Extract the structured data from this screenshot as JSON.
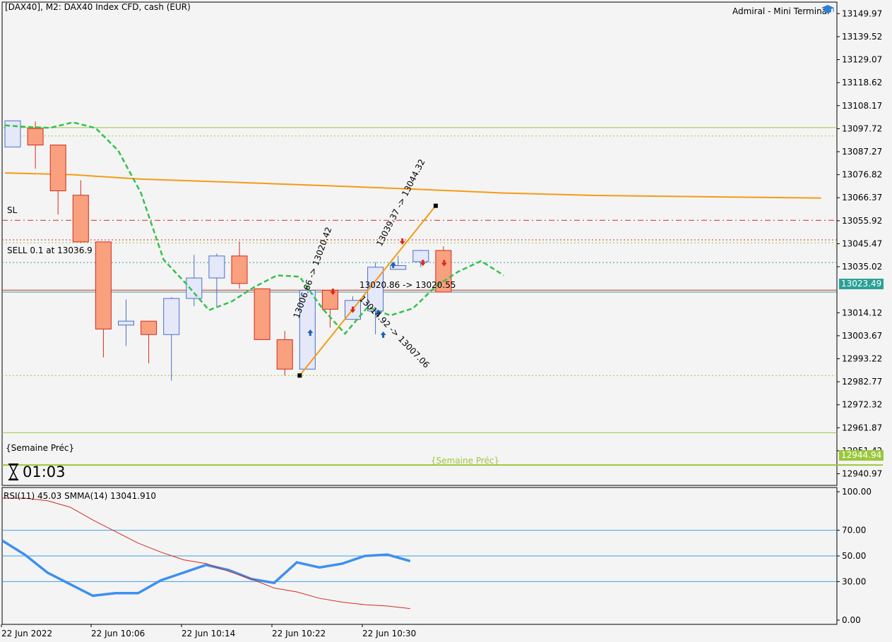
{
  "header": {
    "symbol_info": "[DAX40], M2:  DAX40 Index CFD, cash (EUR)",
    "terminal_name": "Admiral - Mini Terminal"
  },
  "labels": {
    "sl": "SL",
    "sell": "SELL 0.1 at 13036.9",
    "semaine_left": "{Semaine Préc}",
    "semaine_center": "{Semaine Préc}",
    "timer": "01:03",
    "current_price": "13023.49",
    "week_price": "12944.94"
  },
  "trade_annotations": [
    {
      "text": "13006.66 -> 13020.42",
      "x0": 7,
      "y0": 13006.66,
      "x1": 11,
      "y1": 13020.42
    },
    {
      "text": "13039.37 -> 13044.32",
      "x0": 13,
      "y0": 13039.37,
      "x1": 15,
      "y1": 13044.32
    },
    {
      "text": "13020.86 -> 13020.55",
      "x0": 9,
      "y0": 13020.86,
      "x1": 10,
      "y1": 13020.55
    },
    {
      "text": "13014.92 -> 13007.06",
      "x0": 10,
      "y0": 13014.92,
      "x1": 11,
      "y1": 13007.06
    }
  ],
  "colors": {
    "bull_body": "#e4e8f8",
    "bull_border": "#4a6fc7",
    "bear_body": "#f9a07e",
    "bear_border": "#d42a1e",
    "ma_orange": "#f39c12",
    "ma_green": "#33c14a",
    "rsi_line": "#3d8ff0",
    "smma_line": "#d42a1e",
    "price_tag_bg": "#2aa198",
    "week_tag_bg": "#9ac83a"
  },
  "chart_data": [
    {
      "type": "candlestick",
      "title": "[DAX40], M2:  DAX40 Index CFD, cash (EUR)",
      "ylim": [
        12935.7,
        13155.2
      ],
      "y_ticks": [
        13149.97,
        13139.52,
        13129.07,
        13118.62,
        13108.17,
        13097.72,
        13087.27,
        13076.82,
        13066.37,
        13055.92,
        13045.47,
        13035.02,
        13014.12,
        13003.67,
        12993.22,
        12982.77,
        12972.32,
        12961.87,
        12951.42,
        12940.97
      ],
      "x_ticks": [
        "22 Jun 2022",
        "22 Jun 10:06",
        "22 Jun 10:14",
        "22 Jun 10:22",
        "22 Jun 10:30"
      ],
      "candles": [
        {
          "o": 13089.4,
          "h": 13101.3,
          "l": 13089.4,
          "c": 13101.3
        },
        {
          "o": 13097.8,
          "h": 13101.0,
          "l": 13079.5,
          "c": 13090.3
        },
        {
          "o": 13090.3,
          "h": 13090.3,
          "l": 13058.7,
          "c": 13069.5
        },
        {
          "o": 13067.5,
          "h": 13074.3,
          "l": 13046.0,
          "c": 13046.3
        },
        {
          "o": 13046.3,
          "h": 13046.3,
          "l": 12993.8,
          "c": 13006.7
        },
        {
          "o": 13008.5,
          "h": 13020.1,
          "l": 12999.0,
          "c": 13010.3
        },
        {
          "o": 13010.3,
          "h": 13010.3,
          "l": 12991.1,
          "c": 13004.2
        },
        {
          "o": 13004.2,
          "h": 13021.2,
          "l": 12983.3,
          "c": 13020.6
        },
        {
          "o": 13020.6,
          "h": 13040.4,
          "l": 13017.1,
          "c": 13029.9
        },
        {
          "o": 13029.9,
          "h": 13041.0,
          "l": 13017.1,
          "c": 13039.9
        },
        {
          "o": 13039.9,
          "h": 13046.5,
          "l": 13025.1,
          "c": 13027.4
        },
        {
          "o": 13025.0,
          "h": 13025.0,
          "l": 13001.7,
          "c": 13001.9
        },
        {
          "o": 13001.9,
          "h": 13005.8,
          "l": 12985.5,
          "c": 12988.5
        },
        {
          "o": 12988.5,
          "h": 13024.3,
          "l": 12988.5,
          "c": 13024.3
        },
        {
          "o": 13024.3,
          "h": 13024.3,
          "l": 13007.4,
          "c": 13015.7
        },
        {
          "o": 13011.1,
          "h": 13021.6,
          "l": 13011.1,
          "c": 13019.7
        },
        {
          "o": 13014.9,
          "h": 13037.1,
          "l": 13004.3,
          "c": 13034.8
        },
        {
          "o": 13033.8,
          "h": 13039.9,
          "l": 13033.8,
          "c": 13035.5
        },
        {
          "o": 13037.3,
          "h": 13042.7,
          "l": 13034.8,
          "c": 13042.4
        },
        {
          "o": 13042.4,
          "h": 13044.3,
          "l": 13023.5,
          "c": 13023.5
        }
      ],
      "moving_average_orange": [
        [
          0,
          13077.6
        ],
        [
          3,
          13076.8
        ],
        [
          6,
          13074.8
        ],
        [
          10,
          13073.4
        ],
        [
          14,
          13071.9
        ],
        [
          18,
          13070.3
        ],
        [
          22,
          13068.5
        ],
        [
          26,
          13067.4
        ],
        [
          30,
          13066.9
        ],
        [
          36,
          13066.2
        ]
      ],
      "moving_average_green_dashed": [
        [
          0,
          13099.2
        ],
        [
          1,
          13098.5
        ],
        [
          2,
          13098.1
        ],
        [
          3,
          13100.6
        ],
        [
          4,
          13098.0
        ],
        [
          5,
          13087.7
        ],
        [
          6,
          13068.5
        ],
        [
          7,
          13038.2
        ],
        [
          8,
          13027.2
        ],
        [
          9,
          13015.3
        ],
        [
          10,
          13019.2
        ],
        [
          11,
          13025.8
        ],
        [
          12,
          13031.1
        ],
        [
          13,
          13030.5
        ],
        [
          14,
          13016.1
        ],
        [
          15,
          13004.6
        ],
        [
          16,
          13016.7
        ],
        [
          17,
          13012.9
        ],
        [
          18,
          13016.1
        ],
        [
          19,
          13026.1
        ],
        [
          20,
          13032.8
        ],
        [
          21,
          13037.6
        ],
        [
          22,
          13031.1
        ]
      ],
      "horizontal_lines": [
        {
          "value": 13098.2,
          "style": "solid",
          "color": "#9ac83a"
        },
        {
          "value": 13094.4,
          "style": "dotted",
          "color": "#9ac83a"
        },
        {
          "value": 13056.1,
          "style": "dashdot",
          "color": "#d42a1e"
        },
        {
          "value": 13047.2,
          "style": "dotted",
          "color": "#d42a1e"
        },
        {
          "value": 13045.9,
          "style": "dotted",
          "color": "#9ac83a"
        },
        {
          "value": 13036.9,
          "style": "dotted",
          "color": "#2aa198"
        },
        {
          "value": 13024.4,
          "style": "solid",
          "color": "#d42a1e"
        },
        {
          "value": 13023.49,
          "style": "solid",
          "color": "#2aa198"
        },
        {
          "value": 12985.6,
          "style": "dotted",
          "color": "#9ac83a"
        },
        {
          "value": 12959.6,
          "style": "solid",
          "color": "#9ac83a"
        },
        {
          "value": 12944.94,
          "style": "solid_thick",
          "color": "#9ac83a"
        }
      ]
    },
    {
      "type": "line",
      "title": "RSI(11) 45.03 SMMA(14) 13041.910",
      "ylim": [
        0,
        100
      ],
      "y_ticks": [
        100.0,
        70.0,
        50.0,
        30.0,
        0.0
      ],
      "levels": [
        70,
        50,
        30
      ],
      "series": [
        {
          "name": "RSI(11)",
          "x": [
            0,
            1,
            2,
            3,
            4,
            5,
            6,
            7,
            8,
            9,
            10,
            11,
            12,
            13,
            14,
            15,
            16,
            17,
            18
          ],
          "values": [
            62,
            51,
            37,
            28,
            19,
            21,
            21,
            31,
            37,
            43,
            39,
            32,
            29,
            45,
            41,
            44,
            50,
            51,
            46
          ]
        },
        {
          "name": "SMMA(14)",
          "x": [
            0,
            1,
            2,
            3,
            4,
            5,
            6,
            7,
            8,
            9,
            10,
            11,
            12,
            13,
            14,
            15,
            16,
            17,
            18
          ],
          "values": [
            95,
            95,
            93,
            88,
            78,
            69,
            60,
            53,
            47,
            44,
            38,
            32,
            25,
            22,
            17,
            14,
            12,
            11,
            9
          ]
        }
      ]
    }
  ]
}
